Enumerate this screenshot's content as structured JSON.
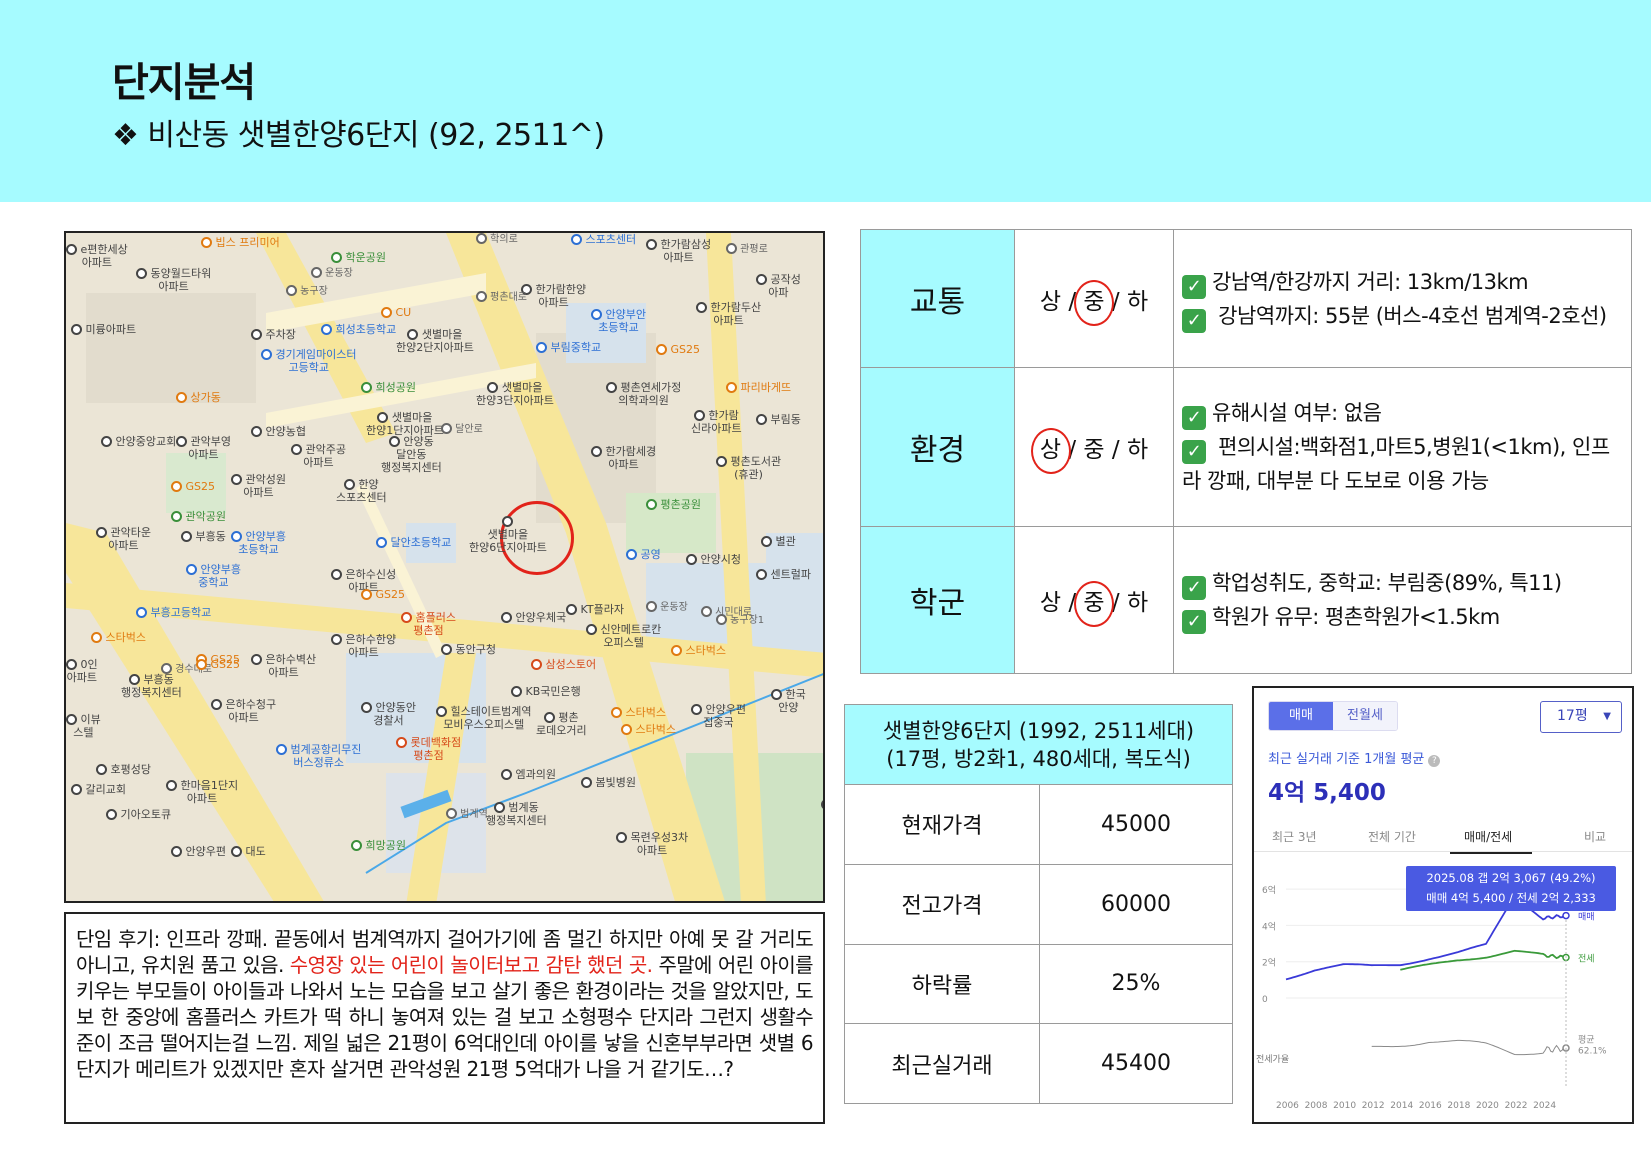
{
  "header": {
    "title": "단지분석",
    "subtitle": "❖ 비산동 샛별한양6단지 (92, 2511^)"
  },
  "map": {
    "target_label": "샛별마을\n한양6단지아파트",
    "labels": [
      {
        "text": "e편한세상\n아파트",
        "c": ""
      },
      {
        "text": "빕스 프리미어",
        "c": "orange"
      },
      {
        "text": "학운공원",
        "c": "green"
      },
      {
        "text": "동양월드타워\n아파트",
        "c": ""
      },
      {
        "text": "운동장",
        "c": "small"
      },
      {
        "text": "농구장",
        "c": "small"
      },
      {
        "text": "CU",
        "c": "orange"
      },
      {
        "text": "미륭아파트",
        "c": ""
      },
      {
        "text": "주차장",
        "c": ""
      },
      {
        "text": "희성초등학교",
        "c": "blue"
      },
      {
        "text": "샛별마을\n한양2단지아파트",
        "c": ""
      },
      {
        "text": "경기게임마이스터\n고등학교",
        "c": "blue"
      },
      {
        "text": "희성공원",
        "c": "green"
      },
      {
        "text": "샛별마을\n한양3단지아파트",
        "c": ""
      },
      {
        "text": "상가동",
        "c": "orange"
      },
      {
        "text": "안양농협",
        "c": ""
      },
      {
        "text": "샛별마을\n한양1단지아파트",
        "c": ""
      },
      {
        "text": "안양중앙교회",
        "c": ""
      },
      {
        "text": "관악부영\n아파트",
        "c": ""
      },
      {
        "text": "안양동\n달안동\n행정복지센터",
        "c": ""
      },
      {
        "text": "관악주공\n아파트",
        "c": ""
      },
      {
        "text": "관악성원\n아파트",
        "c": ""
      },
      {
        "text": "한양\n스포츠센터",
        "c": ""
      },
      {
        "text": "GS25",
        "c": "orange"
      },
      {
        "text": "관악공원",
        "c": "green"
      },
      {
        "text": "관악타운\n아파트",
        "c": ""
      },
      {
        "text": "부흥동",
        "c": ""
      },
      {
        "text": "안양부흥\n초등학교",
        "c": "blue"
      },
      {
        "text": "달안초등학교",
        "c": "blue"
      },
      {
        "text": "안양부흥\n중학교",
        "c": "blue"
      },
      {
        "text": "은하수신성\n아파트",
        "c": ""
      },
      {
        "text": "GS25",
        "c": "orange"
      },
      {
        "text": "부흥고등학교",
        "c": "blue"
      },
      {
        "text": "홈플러스\n평촌점",
        "c": "red"
      },
      {
        "text": "스타벅스",
        "c": "orange"
      },
      {
        "text": "은하수한양\n아파트",
        "c": ""
      },
      {
        "text": "동안구청",
        "c": ""
      },
      {
        "text": "안양우체국",
        "c": ""
      },
      {
        "text": "KT플라자",
        "c": ""
      },
      {
        "text": "은하수벽산\n아파트",
        "c": ""
      },
      {
        "text": "GS25",
        "c": "orange"
      },
      {
        "text": "부흥동\n행정복지센터",
        "c": ""
      },
      {
        "text": "은하수청구\n아파트",
        "c": ""
      },
      {
        "text": "안양동안\n경찰서",
        "c": ""
      },
      {
        "text": "삼성스토어",
        "c": "red"
      },
      {
        "text": "KB국민은행",
        "c": ""
      },
      {
        "text": "힐스테이트범계역\n모비우스오피스텔",
        "c": ""
      },
      {
        "text": "범계공항리무진\n버스정류소",
        "c": "blue"
      },
      {
        "text": "롯데백화점\n평촌점",
        "c": "red"
      },
      {
        "text": "호평성당",
        "c": ""
      },
      {
        "text": "한마음1단지\n아파트",
        "c": ""
      },
      {
        "text": "기아오토큐",
        "c": ""
      },
      {
        "text": "안양우편",
        "c": ""
      },
      {
        "text": "대도",
        "c": ""
      },
      {
        "text": "희망공원",
        "c": "green"
      },
      {
        "text": "범계동\n행정복지센터",
        "c": ""
      },
      {
        "text": "평촌\n로데오거리",
        "c": ""
      },
      {
        "text": "스타벅스",
        "c": "orange"
      },
      {
        "text": "봄빛병원",
        "c": ""
      },
      {
        "text": "목련우성3차\n아파트",
        "c": ""
      },
      {
        "text": "안양우편\n집중국",
        "c": ""
      },
      {
        "text": "스타벅스",
        "c": "orange"
      },
      {
        "text": "신안메트로칸\n오피스텔",
        "c": ""
      },
      {
        "text": "농구장1",
        "c": "small"
      },
      {
        "text": "안양시청",
        "c": ""
      },
      {
        "text": "공영",
        "c": "blue"
      },
      {
        "text": "운동장",
        "c": "small"
      },
      {
        "text": "평촌공원",
        "c": "green"
      },
      {
        "text": "평촌도서관\n(휴관)",
        "c": ""
      },
      {
        "text": "한가람세경\n아파트",
        "c": ""
      },
      {
        "text": "한가람\n신라아파트",
        "c": ""
      },
      {
        "text": "평촌연세가정\n의학과의원",
        "c": ""
      },
      {
        "text": "파리바게뜨",
        "c": "orange"
      },
      {
        "text": "부림중학교",
        "c": "blue"
      },
      {
        "text": "GS25",
        "c": "orange"
      },
      {
        "text": "안양부안\n초등학교",
        "c": "blue"
      },
      {
        "text": "한가람한양\n아파트",
        "c": ""
      },
      {
        "text": "한가람두산\n아파트",
        "c": ""
      },
      {
        "text": "한가람삼성\n아파트",
        "c": ""
      },
      {
        "text": "스포츠센터",
        "c": "blue"
      },
      {
        "text": "공작성\n아파",
        "c": ""
      },
      {
        "text": "부림동",
        "c": ""
      },
      {
        "text": "센트럴파",
        "c": ""
      },
      {
        "text": "평촌",
        "c": ""
      },
      {
        "text": "별관",
        "c": ""
      },
      {
        "text": "시민대로",
        "c": "small"
      },
      {
        "text": "평촌대로",
        "c": "small"
      },
      {
        "text": "관평로",
        "c": "small"
      },
      {
        "text": "학의로",
        "c": "small"
      },
      {
        "text": "달안로",
        "c": "small"
      },
      {
        "text": "경수대로",
        "c": "small"
      },
      {
        "text": "범계역",
        "c": "small"
      },
      {
        "text": "엠과의원",
        "c": ""
      },
      {
        "text": "스타벅스",
        "c": "orange"
      },
      {
        "text": "GS25",
        "c": "orange"
      },
      {
        "text": "한국\n안양",
        "c": ""
      },
      {
        "text": "0인\n아파트",
        "c": ""
      },
      {
        "text": "이뷰\n스텔",
        "c": ""
      },
      {
        "text": "갈리교회",
        "c": ""
      }
    ]
  },
  "review": {
    "part1": "단임 후기: 인프라 깡패. 끝동에서 범계역까지 걸어가기에 좀 멀긴 하지만 아예 못 갈 거리도 아니고, 유치원 품고 있음. ",
    "highlight": "수영장 있는 어린이 놀이터보고 감탄 했던 곳.",
    "part2": " 주말에 어린 아이를 키우는 부모들이 아이들과 나와서 노는 모습을 보고 살기 좋은 환경이라는 것을 알았지만, 도보 한 중앙에 홈플러스 카트가 떡 하니 놓여져 있는 걸 보고 소형평수 단지라 그런지 생활수준이 조금 떨어지는걸 느낌. 제일 넓은 21평이 6억대인데 아이를 낳을 신혼부부라면 샛별 6단지가 메리트가 있겠지만 혼자 살거면 관악성원 21평 5억대가 나을 거 같기도…?"
  },
  "analysis": {
    "rows": [
      {
        "category": "교통",
        "grade_high": "상",
        "grade_mid": "중",
        "grade_low": "하",
        "sep1": " / ",
        "sep2": " / ",
        "line1": "강남역/한강까지 거리: 13km/13km",
        "line2": " 강남역까지:  55분  (버스-4호선  범계역-2호선)"
      },
      {
        "category": "환경",
        "grade_high": "상",
        "grade_mid": "중",
        "grade_low": "하",
        "sep1": " / ",
        "sep2": " / ",
        "line1": "유해시설 여부: 없음",
        "line2": "  편의시설:백화점1,마트5,병원1(<1km),  인프라 깡패, 대부분 다 도보로 이용 가능"
      },
      {
        "category": "학군",
        "grade_high": "상",
        "grade_mid": "중",
        "grade_low": "하",
        "sep1": " / ",
        "sep2": " / ",
        "line1": "학업성취도, 중학교: 부림중(89%, 특11)",
        "line2": "학원가 유무: 평촌학원가<1.5km"
      }
    ],
    "check_icon": "✓",
    "check_color": "#3aa34a",
    "circle_color": "#e2231a"
  },
  "price_table": {
    "header_line1": "샛별한양6단지 (1992, 2511세대)",
    "header_line2": "(17평, 방2화1, 480세대, 복도식)",
    "rows": [
      {
        "label": "현재가격",
        "value": "45000"
      },
      {
        "label": "전고가격",
        "value": "60000"
      },
      {
        "label": "하락률",
        "value": "25%"
      },
      {
        "label": "최근실거래",
        "value": "45400"
      }
    ]
  },
  "widget": {
    "seg_sale": "매매",
    "seg_jeonse": "전월세",
    "size": "17평",
    "avg_label": "최근 실거래 기준 1개월 평균",
    "avg_value": "4억 5,400",
    "tabs": [
      "최근 3년",
      "전체 기간",
      "매매/전세",
      "비교"
    ],
    "tooltip_line1": "2025.08  갭 2억 3,067 (49.2%)",
    "tooltip_line2": "매매 4억 5,400 / 전세 2억 2,333",
    "accent": "#4a5ae2"
  },
  "chart_data": {
    "type": "line",
    "x": [
      2006,
      2008,
      2010,
      2012,
      2014,
      2016,
      2018,
      2020,
      2022,
      2024,
      2025.6
    ],
    "xticks": [
      "2006",
      "2008",
      "2010",
      "2012",
      "2014",
      "2016",
      "2018",
      "2020",
      "2022",
      "2024"
    ],
    "yticks": [
      "6억",
      "4억",
      "2억",
      "0"
    ],
    "y_extra_label": "전세가율",
    "ylim": [
      0,
      6.5
    ],
    "series": [
      {
        "name": "매매",
        "color": "#3a3ad8",
        "values": [
          1.1,
          1.55,
          1.8,
          1.75,
          1.85,
          2.2,
          2.5,
          2.9,
          5.6,
          4.4,
          4.54
        ]
      },
      {
        "name": "전세",
        "color": "#3a9a3a",
        "values": [
          null,
          null,
          null,
          null,
          1.5,
          1.8,
          2.1,
          2.3,
          2.6,
          2.35,
          2.23
        ]
      },
      {
        "name": "평균\n62.1%",
        "color": "#8a8a8a",
        "values": [
          null,
          null,
          null,
          0.5,
          0.6,
          0.7,
          0.65,
          0.55,
          0.35,
          0.45,
          0.5
        ]
      }
    ],
    "legend": "right"
  }
}
